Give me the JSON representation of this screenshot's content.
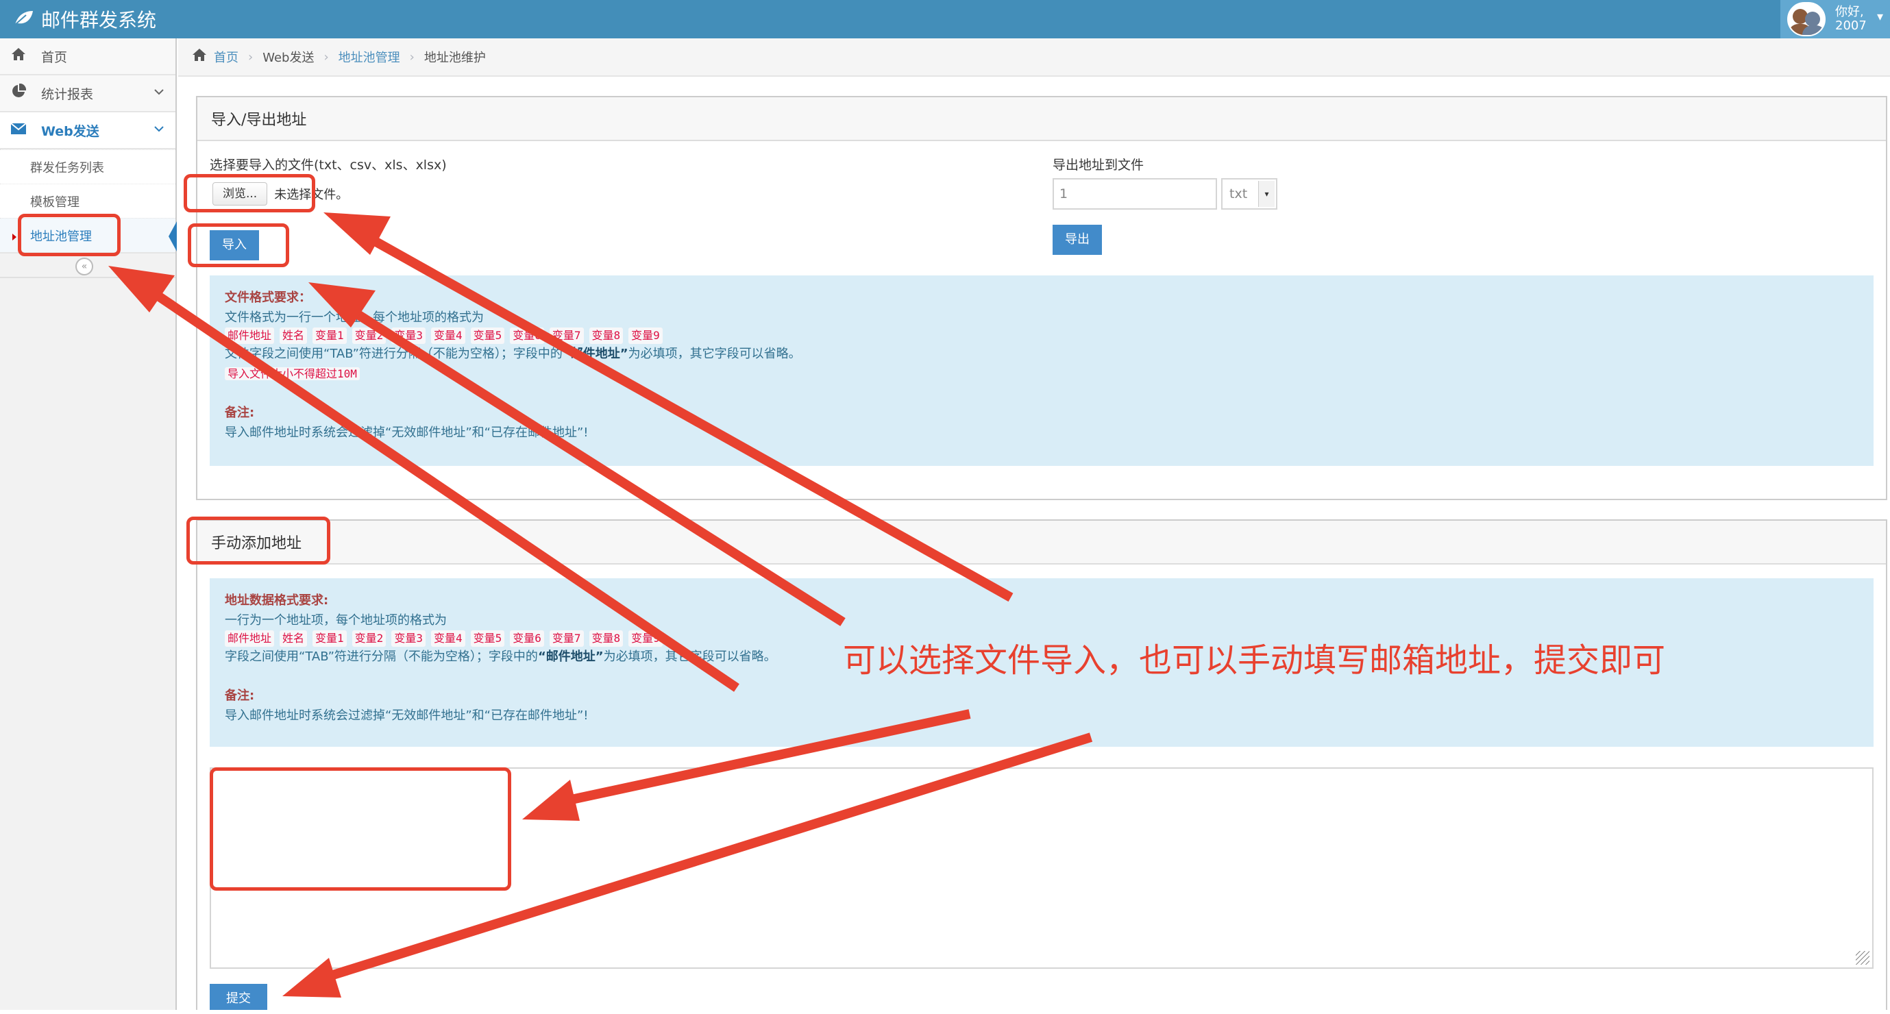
{
  "app": {
    "title": "邮件群发系统"
  },
  "user": {
    "greeting": "你好,",
    "name": "2007"
  },
  "sidebar": {
    "items": [
      {
        "label": "首页",
        "icon": "home-icon"
      },
      {
        "label": "统计报表",
        "icon": "pie-chart-icon"
      },
      {
        "label": "Web发送",
        "icon": "envelope-icon"
      }
    ],
    "sub_items": [
      {
        "label": "群发任务列表"
      },
      {
        "label": "模板管理"
      },
      {
        "label": "地址池管理"
      }
    ]
  },
  "breadcrumb": {
    "home": "首页",
    "web_send": "Web发送",
    "pool": "地址池管理",
    "current": "地址池维护"
  },
  "import_panel": {
    "title": "导入/导出地址",
    "choose_label": "选择要导入的文件(txt、csv、xls、xlsx)",
    "browse_label": "浏览...",
    "no_file": "未选择文件。",
    "import_button": "导入",
    "export_label": "导出地址到文件",
    "export_value": "1",
    "export_format": "txt",
    "export_button": "导出",
    "info": {
      "heading": "文件格式要求：",
      "line1": "文件格式为一行一个地址，每个地址项的格式为",
      "tags": [
        "邮件地址",
        "姓名",
        "变量1",
        "变量2",
        "变量3",
        "变量4",
        "变量5",
        "变量6",
        "变量7",
        "变量8",
        "变量9"
      ],
      "line3_pre": "文件字段之间使用“TAB”符进行分隔（不能为空格）；字段中的",
      "line3_bold": "“邮件地址”",
      "line3_post": "为必填项，其它字段可以省略。",
      "size_tag": "导入文件大小不得超过10M",
      "note_heading": "备注:",
      "note_text": "导入邮件地址时系统会过滤掉“无效邮件地址”和“已存在邮件地址”!"
    }
  },
  "manual_panel": {
    "title": "手动添加地址",
    "info": {
      "heading": "地址数据格式要求:",
      "line1": "一行为一个地址项，每个地址项的格式为",
      "tags": [
        "邮件地址",
        "姓名",
        "变量1",
        "变量2",
        "变量3",
        "变量4",
        "变量5",
        "变量6",
        "变量7",
        "变量8",
        "变量9"
      ],
      "line3_pre": "字段之间使用“TAB”符进行分隔（不能为空格）；字段中的",
      "line3_bold": "“邮件地址”",
      "line3_post": "为必填项，其它字段可以省略。",
      "note_heading": "备注:",
      "note_text": "导入邮件地址时系统会过滤掉“无效邮件地址”和“已存在邮件地址”!"
    },
    "submit_button": "提交"
  },
  "annotation": {
    "note": "可以选择文件导入，也可以手动填写邮箱地址，提交即可",
    "color": "#e8412f"
  }
}
